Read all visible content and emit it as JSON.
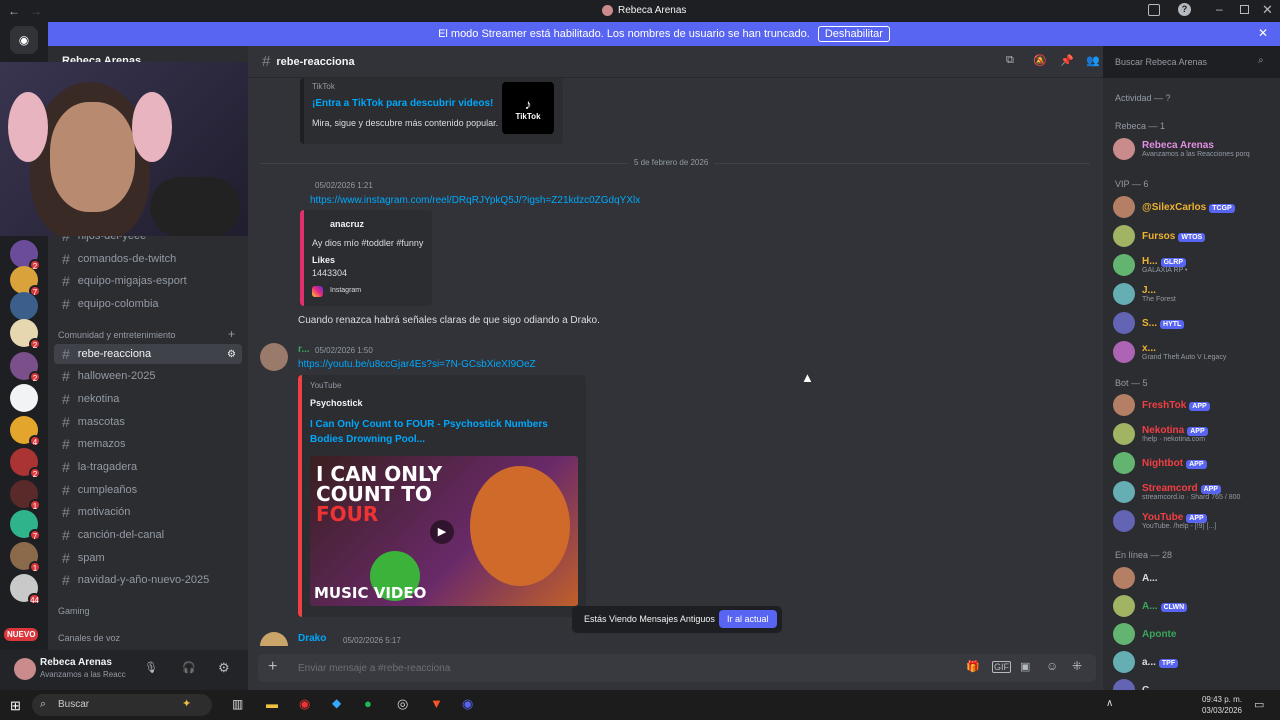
{
  "window": {
    "title": "Rebeca Arenas"
  },
  "streamer_bar": {
    "message": "El modo Streamer está habilitado. Los nombres de usuario se han truncado.",
    "button": "Deshabilitar"
  },
  "server": {
    "name": "Rebeca Arenas"
  },
  "badges": [
    "2",
    "7",
    "2",
    "2",
    "4",
    "2",
    "1",
    "7",
    "1",
    "44"
  ],
  "nuevo": "NUEVO",
  "channels": {
    "top": [
      "hijos-del-yeee",
      "comandos-de-twitch",
      "equipo-migajas-esport",
      "equipo-colombia"
    ],
    "cat1": "Comunidad y entretenimiento",
    "list": [
      "rebe-reacciona",
      "halloween-2025",
      "nekotina",
      "mascotas",
      "memazos",
      "la-tragadera",
      "cumpleaños",
      "motivación",
      "canción-del-canal",
      "spam",
      "navidad-y-año-nuevo-2025"
    ],
    "cat2": "Gaming",
    "cat3": "Canales de voz"
  },
  "user": {
    "name": "Rebeca Arenas",
    "status": "Avanzamos a las Reacc"
  },
  "header": {
    "channel": "rebe-reacciona",
    "search_placeholder": "Buscar Rebeca Arenas"
  },
  "messages": {
    "tiktok": {
      "provider": "TikTok",
      "title": "¡Entra a TikTok para descubrir videos!",
      "desc": "Mira, sigue y descubre más contenido popular.",
      "logo": "TikTok"
    },
    "date_divider": "5 de febrero de 2026",
    "m1": {
      "time": "05/02/2026 1:21",
      "link": "https://www.instagram.com/reel/DRqRJYpkQ5J/?igsh=Z21kdzc0ZGdqYXlx",
      "embed_author": "anacruz",
      "embed_text": "Ay dios mío #toddler #funny",
      "likes_label": "Likes",
      "likes": "1443304",
      "footer": "Instagram"
    },
    "m1_text": "Cuando renazca habrá señales claras de que sigo odiando a Drako.",
    "m2": {
      "author": "r...",
      "time": "05/02/2026 1:50",
      "link": "https://youtu.be/u8ccGjar4Es?si=7N-GCsbXieXI9OeZ",
      "provider": "YouTube",
      "channel": "Psychostick",
      "title": "I Can Only Count to FOUR - Psychostick Numbers Bodies Drowning Pool...",
      "thumb_line1": "I CAN ONLY",
      "thumb_line2": "COUNT TO",
      "thumb_line3": "FOUR",
      "thumb_line4": "MUSIC VIDEO"
    },
    "m3": {
      "author": "Drako",
      "time": "05/02/2026 5:17"
    }
  },
  "old_messages": {
    "text": "Estás Viendo Mensajes Antiguos",
    "button": "Ir al actual"
  },
  "composer": {
    "placeholder": "Enviar mensaje a #rebe-reacciona"
  },
  "members": {
    "activity": "Actividad — ?",
    "g1": "Rebeca — 1",
    "rebeca": {
      "name": "Rebeca Arenas",
      "sub": "Avanzamos a las Reacciones porq"
    },
    "g2": "VIP — 6",
    "vip": [
      {
        "name": "@SilexCarlos",
        "tag": "TCGP",
        "sub": "",
        "color": "#f0b232"
      },
      {
        "name": "Fursos",
        "tag": "WTOS",
        "sub": "",
        "color": "#f0b232"
      },
      {
        "name": "H...",
        "tag": "GLRP",
        "sub": "GALAXIA RP •",
        "color": "#f0b232"
      },
      {
        "name": "J...",
        "tag": "",
        "sub": "The Forest",
        "color": "#f0b232"
      },
      {
        "name": "S...",
        "tag": "HYTL",
        "sub": "",
        "color": "#f0b232"
      },
      {
        "name": "x...",
        "tag": "",
        "sub": "Grand Theft Auto V Legacy",
        "color": "#f0b232"
      }
    ],
    "g3": "Bot — 5",
    "bots": [
      {
        "name": "FreshTok",
        "tag": "APP",
        "sub": "",
        "color": "#f23f43"
      },
      {
        "name": "Nekotina",
        "tag": "APP",
        "sub": "!help · nekotina.com",
        "color": "#f23f43"
      },
      {
        "name": "Nightbot",
        "tag": "APP",
        "sub": "",
        "color": "#f23f43"
      },
      {
        "name": "Streamcord",
        "tag": "APP",
        "sub": "streamcord.io · Shard 765 / 800",
        "color": "#f23f43"
      },
      {
        "name": "YouTube",
        "tag": "APP",
        "sub": "YouTube. /help - [!9] [...]",
        "color": "#f23f43"
      }
    ],
    "g4": "En línea — 28",
    "online": [
      {
        "name": "A...",
        "tag": "",
        "color": "#dbdee1"
      },
      {
        "name": "A...",
        "tag": "CLWN",
        "color": "#3ba55c"
      },
      {
        "name": "Aponte",
        "tag": "",
        "color": "#3ba55c"
      },
      {
        "name": "a...",
        "tag": "TPF",
        "color": "#dbdee1"
      },
      {
        "name": "C...",
        "tag": "",
        "color": "#dbdee1"
      }
    ]
  },
  "taskbar": {
    "search": "Buscar",
    "time": "09:43 p. m.",
    "date": "03/03/2026"
  },
  "colors": {
    "accent": "#5865f2",
    "bg_main": "#313338",
    "bg_sidebar": "#2b2d31",
    "link": "#00a8fc"
  }
}
